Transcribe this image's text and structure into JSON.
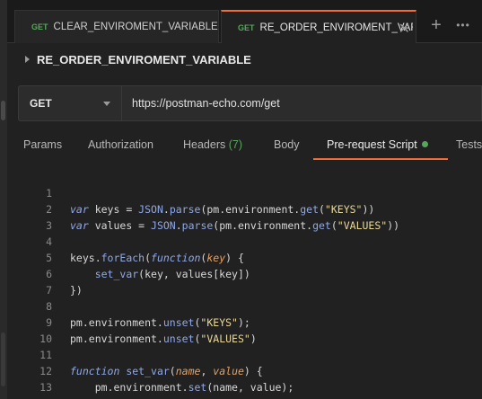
{
  "tabs": [
    {
      "method": "GET",
      "label": "CLEAR_ENVIROMENT_VARIABLE"
    },
    {
      "method": "GET",
      "label": "RE_ORDER_ENVIROMENT_VARIABLE"
    }
  ],
  "request": {
    "name": "RE_ORDER_ENVIROMENT_VARIABLE",
    "method": "GET",
    "url": "https://postman-echo.com/get"
  },
  "request_tabs": {
    "params": "Params",
    "authorization": "Authorization",
    "headers": "Headers",
    "headers_count": "(7)",
    "body": "Body",
    "prerequest": "Pre-request Script",
    "tests": "Tests"
  },
  "code": {
    "line_numbers": [
      "1",
      "2",
      "3",
      "4",
      "5",
      "6",
      "7",
      "8",
      "9",
      "10",
      "11",
      "12",
      "13"
    ],
    "l1": {
      "t1": "var",
      "t2": " keys = ",
      "t3": "JSON",
      "t4": ".",
      "t5": "parse",
      "t6": "(pm.environment.",
      "t7": "get",
      "t8": "(",
      "t9": "\"KEYS\"",
      "t10": "))"
    },
    "l2": {
      "t1": "var",
      "t2": " values = ",
      "t3": "JSON",
      "t4": ".",
      "t5": "parse",
      "t6": "(pm.environment.",
      "t7": "get",
      "t8": "(",
      "t9": "\"VALUES\"",
      "t10": "))"
    },
    "l4": {
      "t1": "keys.",
      "t2": "forEach",
      "t3": "(",
      "t4": "function",
      "t5": "(",
      "t6": "key",
      "t7": ") {"
    },
    "l5": {
      "t1": "    ",
      "t2": "set_var",
      "t3": "(key, values[key])"
    },
    "l6": {
      "t1": "})"
    },
    "l8": {
      "t1": "pm.environment.",
      "t2": "unset",
      "t3": "(",
      "t4": "\"KEYS\"",
      "t5": ");"
    },
    "l9": {
      "t1": "pm.environment.",
      "t2": "unset",
      "t3": "(",
      "t4": "\"VALUES\"",
      "t5": ")"
    },
    "l11": {
      "t1": "function",
      "t2": " ",
      "t3": "set_var",
      "t4": "(",
      "t5": "name",
      "t6": ", ",
      "t7": "value",
      "t8": ") {"
    },
    "l12": {
      "t1": "    pm.environment.",
      "t2": "set",
      "t3": "(name, value);"
    },
    "l13": {
      "t1": "}"
    }
  },
  "colors": {
    "accent": "#f26b3a",
    "method_get": "#58a55c"
  }
}
